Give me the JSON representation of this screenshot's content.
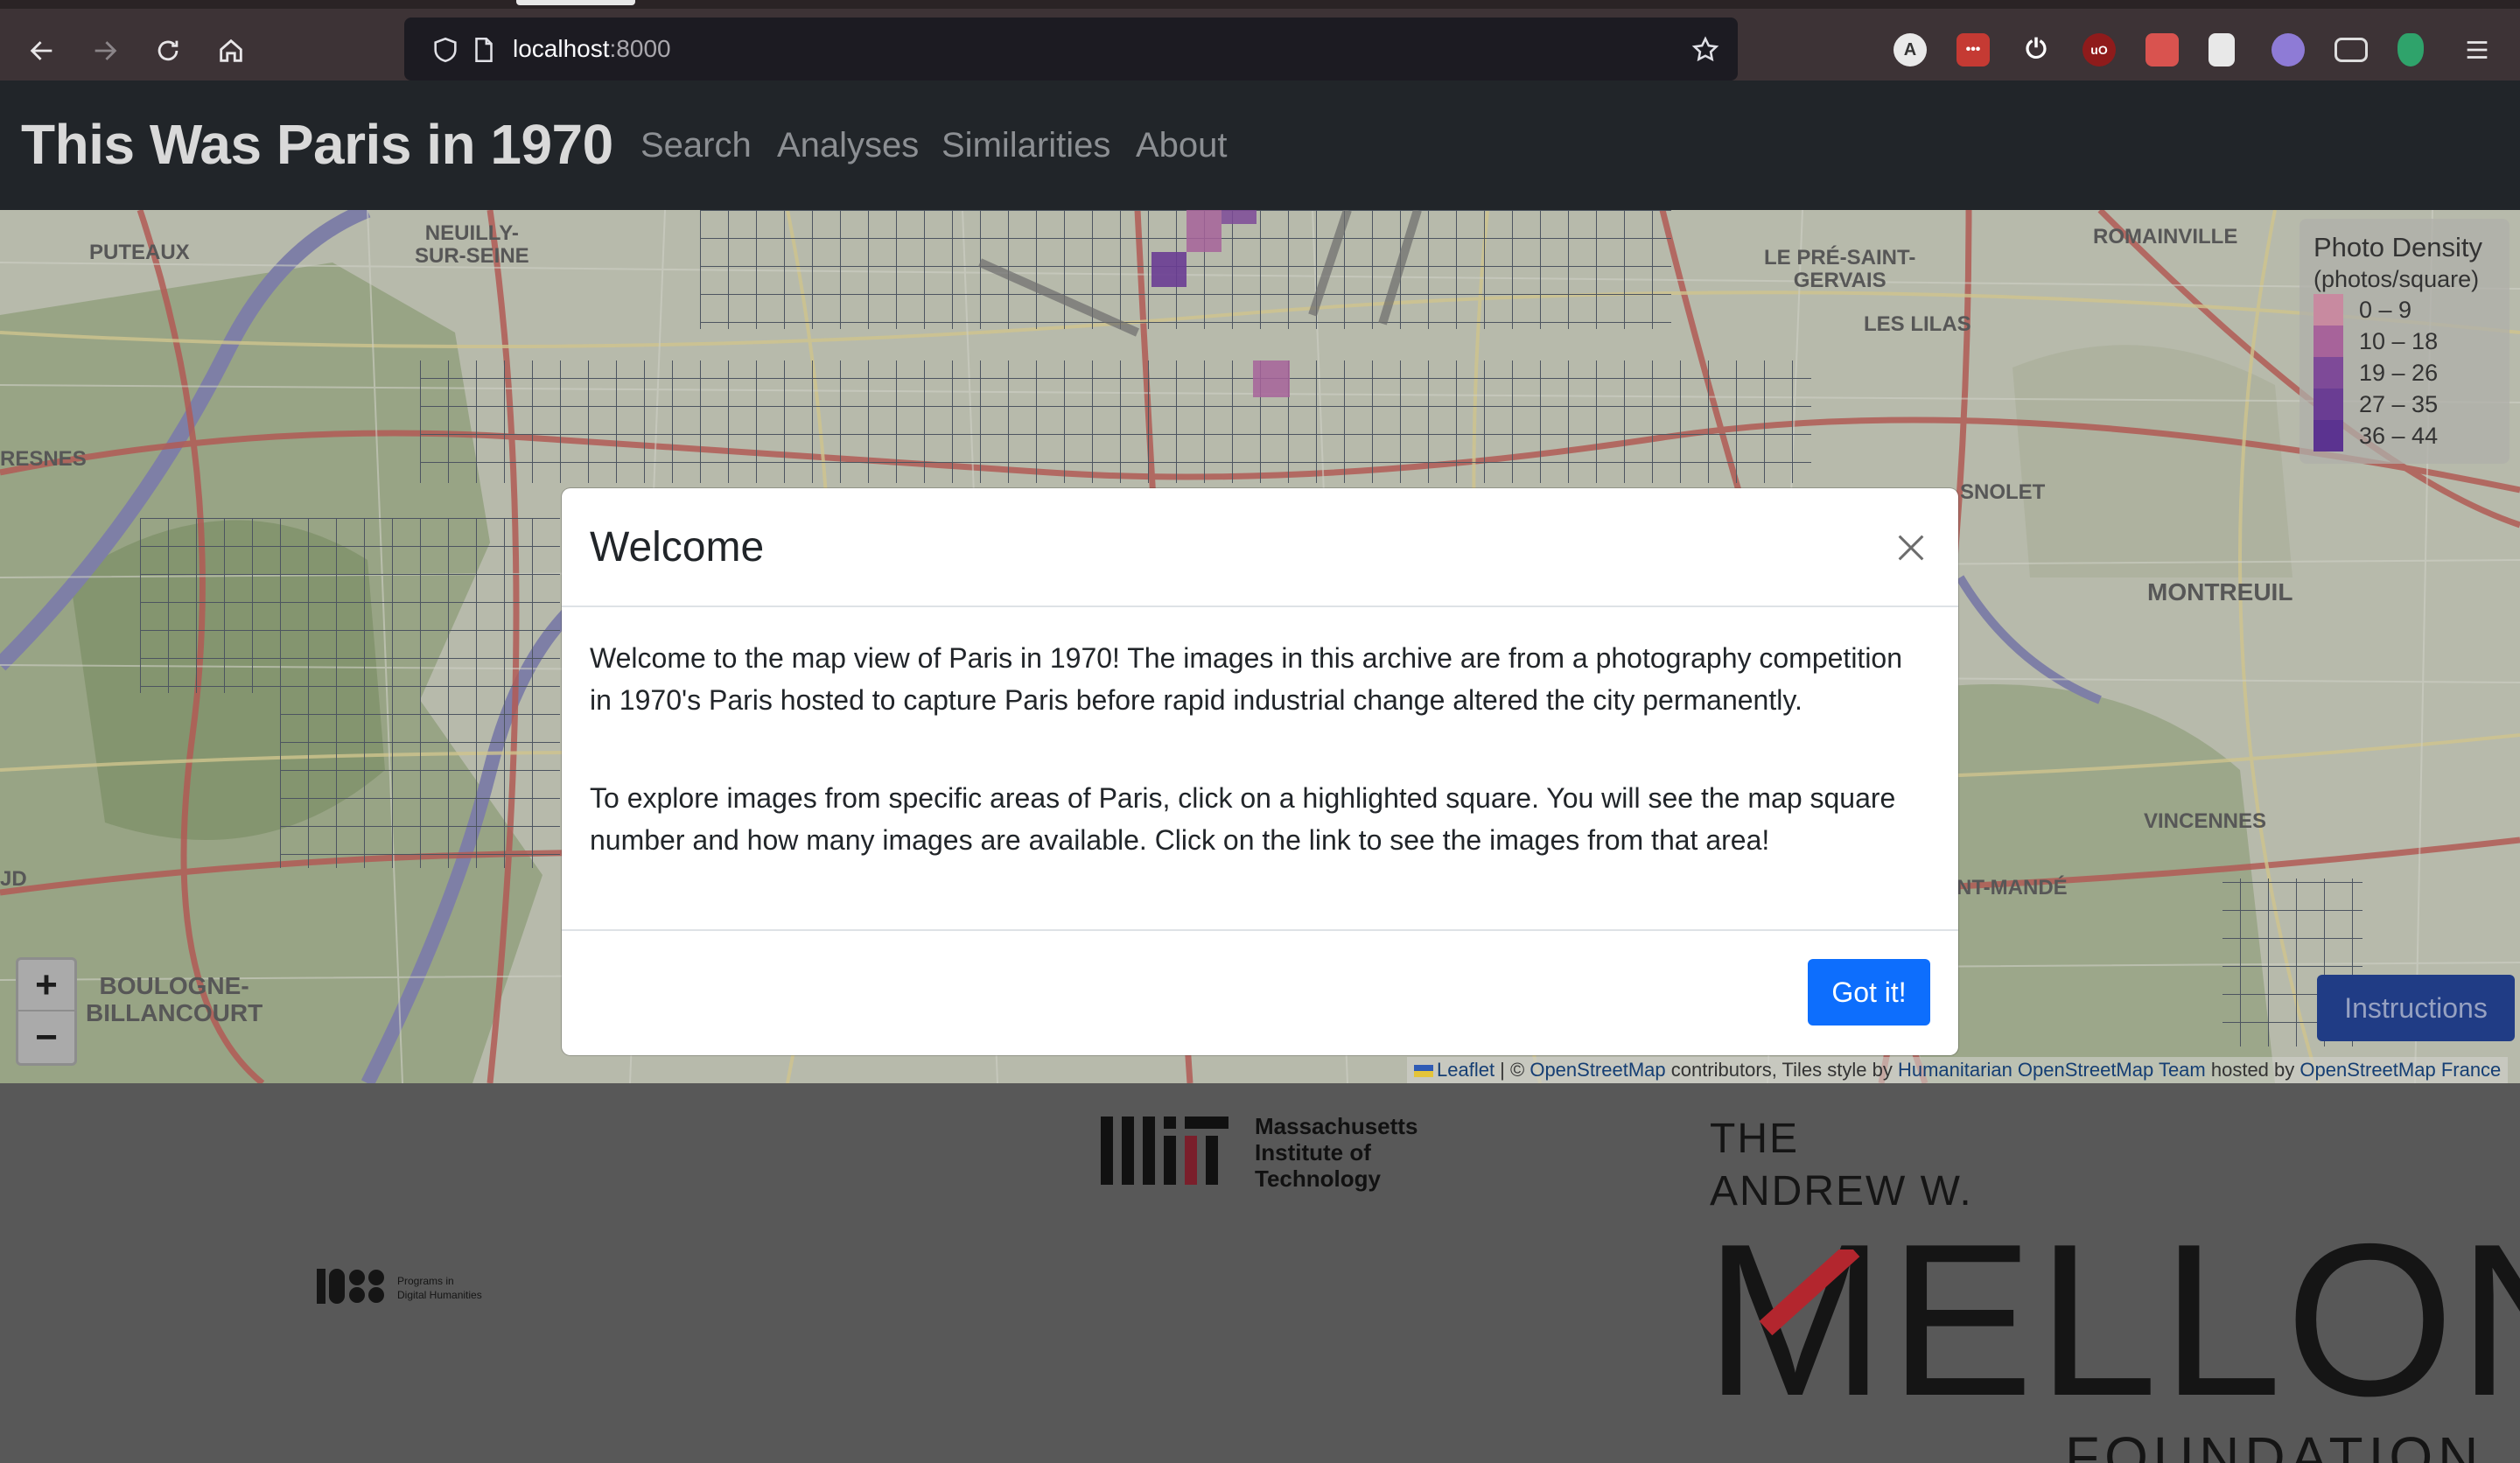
{
  "browser": {
    "url_host": "localhost",
    "url_port": ":8000",
    "extensions": [
      "A",
      "•••",
      "⏻",
      "uO",
      "",
      "",
      "",
      "",
      "",
      ""
    ]
  },
  "navbar": {
    "brand": "This Was Paris in 1970",
    "links": [
      "Search",
      "Analyses",
      "Similarities",
      "About"
    ]
  },
  "map": {
    "places": [
      "PUTEAUX",
      "NEUILLY-\nSUR-SEINE",
      "LE PRÉ-SAINT-\nGERVAIS",
      "ROMAINVILLE",
      "LES LILAS",
      "RESNES",
      "MONTREUIL",
      "SNOLET",
      "VINCENNES",
      "NT-MANDÉ",
      "BOULOGNE-\nBILLANCOURT",
      "JD"
    ],
    "zoom_in": "+",
    "zoom_out": "−",
    "legend": {
      "title": "Photo Density",
      "subtitle": "(photos/square)",
      "items": [
        {
          "label": "0 – 9",
          "color": "#c88aa0"
        },
        {
          "label": "10 – 18",
          "color": "#a7639a"
        },
        {
          "label": "19 – 26",
          "color": "#7e4a98"
        },
        {
          "label": "27 – 35",
          "color": "#6a3d93"
        },
        {
          "label": "36 – 44",
          "color": "#5b3390"
        }
      ]
    },
    "instructions_label": "Instructions",
    "attribution": {
      "leaflet": "Leaflet",
      "sep": " | © ",
      "osm": "OpenStreetMap",
      "text1": " contributors, Tiles style by ",
      "hot": "Humanitarian OpenStreetMap Team",
      "text2": " hosted by ",
      "osmfr": "OpenStreetMap France"
    }
  },
  "footer": {
    "mit_lines": [
      "Massachusetts",
      "Institute of",
      "Technology"
    ],
    "dh_lines": [
      "Programs in",
      "Digital Humanities"
    ],
    "mellon_the": "THE",
    "mellon_andrew": "ANDREW W.",
    "mellon_big": "MELLON",
    "mellon_foundation": "FOUNDATION"
  },
  "modal": {
    "title": "Welcome",
    "para1": "Welcome to the map view of Paris in 1970! The images in this archive are from a photography competition in 1970's Paris hosted to capture Paris before rapid industrial change altered the city permanently.",
    "para2": "To explore images from specific areas of Paris, click on a highlighted square. You will see the map square number and how many images are available. Click on the link to see the images from that area!",
    "button": "Got it!"
  },
  "colors": {
    "primary": "#0d6efd",
    "navbar_bg": "#212529"
  }
}
